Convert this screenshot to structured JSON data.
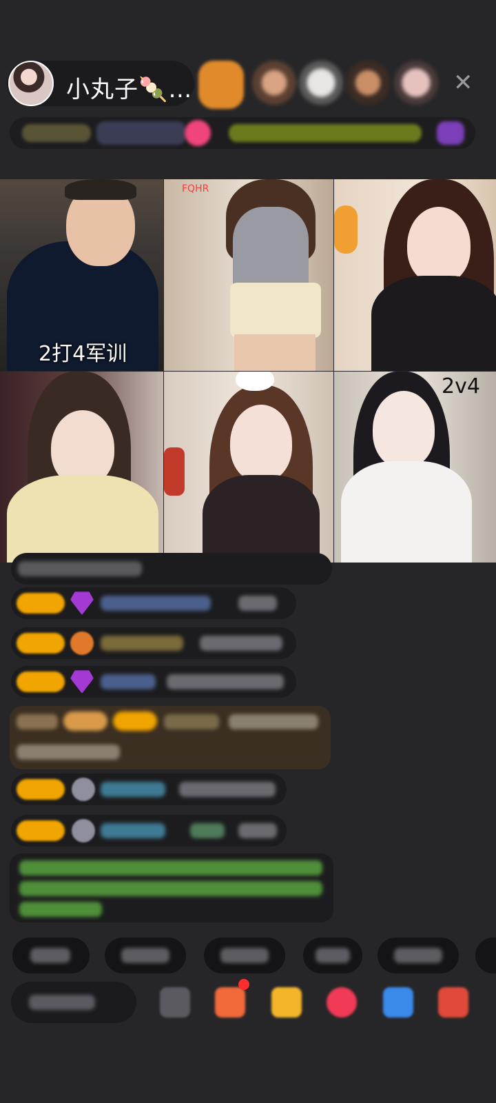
{
  "host": {
    "name": "小丸子",
    "name_suffix": "🍡…"
  },
  "grid": {
    "cells": [
      {
        "label": "2打4军训"
      },
      {
        "label": "FQHR"
      },
      {
        "label": ""
      },
      {
        "label": ""
      },
      {
        "label": ""
      },
      {
        "label": "2v4"
      }
    ]
  },
  "colors": {
    "background": "#262628",
    "badge": "#f1a500",
    "gift_message_bg": "#3b2f22",
    "system_message_text": "#4f8f3a"
  },
  "icons": {
    "close": "close-icon",
    "gem": "diamond-icon",
    "gift": "gift-icon"
  }
}
